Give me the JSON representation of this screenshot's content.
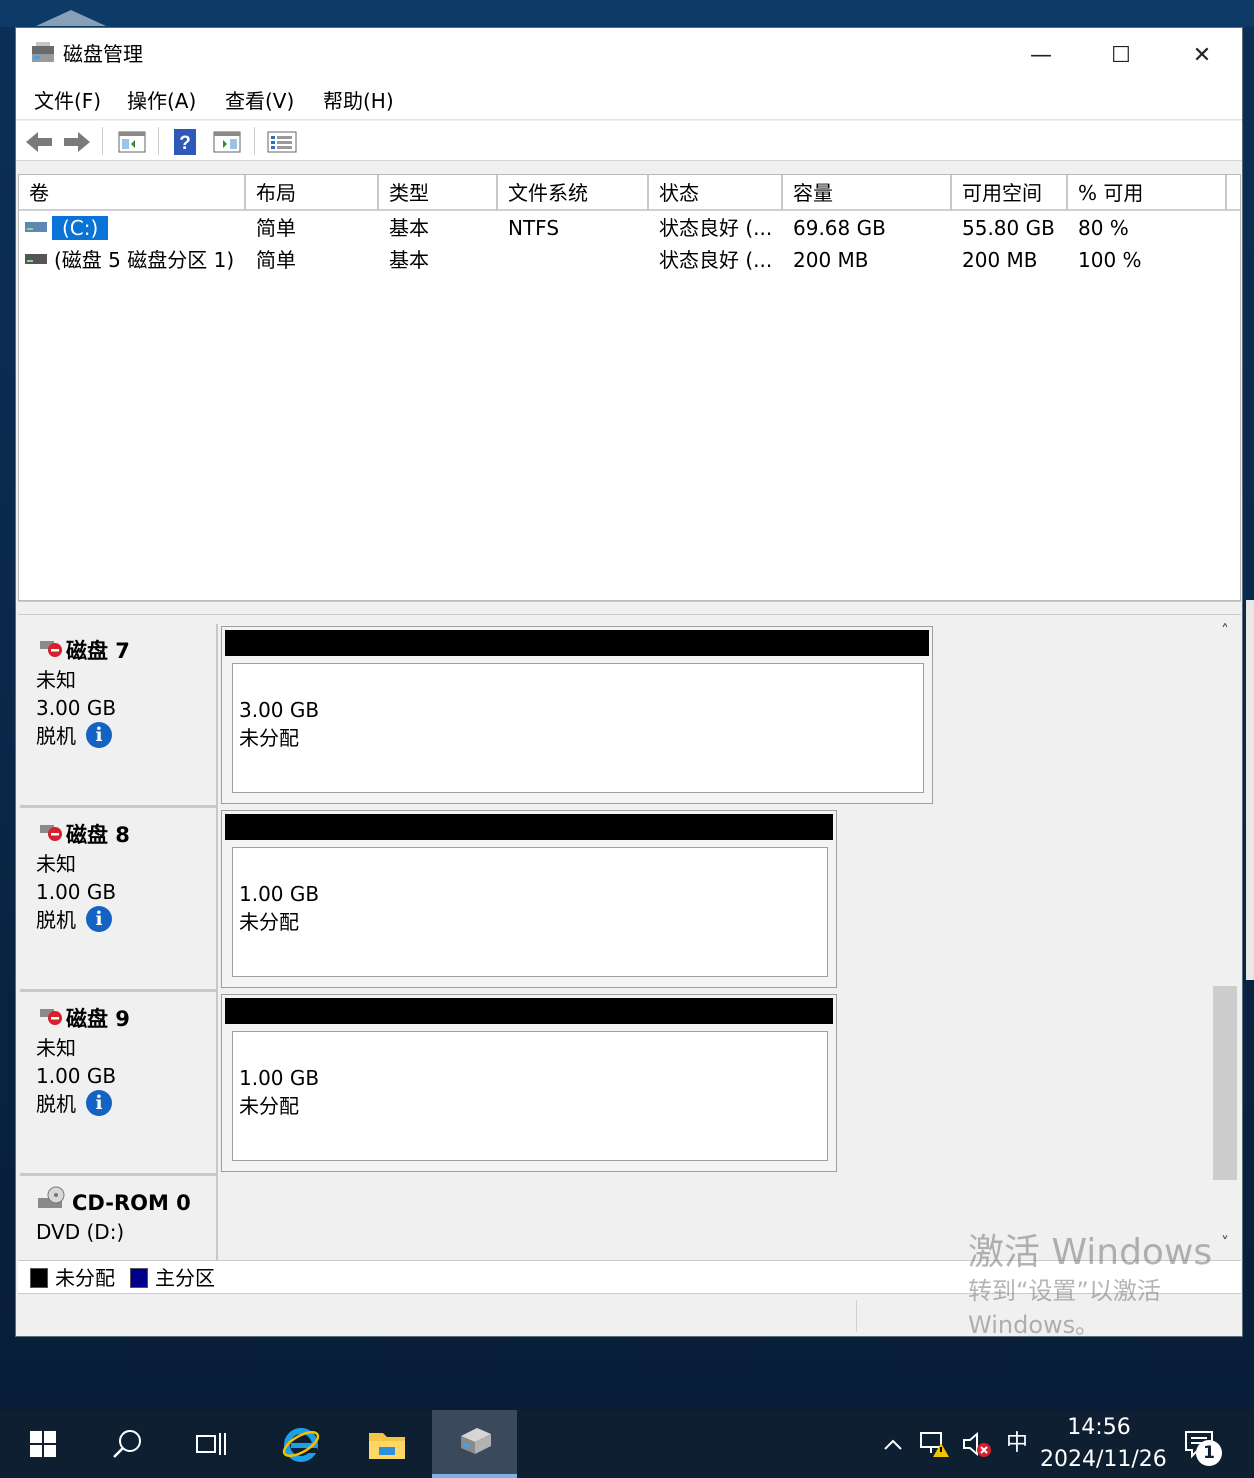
{
  "window": {
    "title": "磁盘管理",
    "controls": {
      "minimize": "—",
      "maximize": "☐",
      "close": "✕"
    }
  },
  "menu": [
    {
      "label": "文件(F)"
    },
    {
      "label": "操作(A)"
    },
    {
      "label": "查看(V)"
    },
    {
      "label": "帮助(H)"
    }
  ],
  "toolbar": {
    "icons": [
      "back-arrow-icon",
      "forward-arrow-icon",
      "show-hide-console-tree-icon",
      "help-icon",
      "show-action-pane-icon",
      "properties-list-icon"
    ]
  },
  "volume_list": {
    "columns": [
      "卷",
      "布局",
      "类型",
      "文件系统",
      "状态",
      "容量",
      "可用空间",
      "% 可用"
    ],
    "rows": [
      {
        "volume": "(C:)",
        "layout": "简单",
        "type": "基本",
        "fs": "NTFS",
        "status": "状态良好 (...",
        "capacity": "69.68 GB",
        "free": "55.80 GB",
        "pct": "80 %"
      },
      {
        "volume": "(磁盘 5 磁盘分区 1)",
        "layout": "简单",
        "type": "基本",
        "fs": "",
        "status": "状态良好 (...",
        "capacity": "200 MB",
        "free": "200 MB",
        "pct": "100 %"
      }
    ]
  },
  "disks": [
    {
      "name": "磁盘 7",
      "kind": "未知",
      "size": "3.00 GB",
      "state": "脱机",
      "partition": {
        "size": "3.00 GB",
        "status": "未分配"
      }
    },
    {
      "name": "磁盘 8",
      "kind": "未知",
      "size": "1.00 GB",
      "state": "脱机",
      "partition": {
        "size": "1.00 GB",
        "status": "未分配"
      }
    },
    {
      "name": "磁盘 9",
      "kind": "未知",
      "size": "1.00 GB",
      "state": "脱机",
      "partition": {
        "size": "1.00 GB",
        "status": "未分配"
      }
    }
  ],
  "cdrom": {
    "name": "CD-ROM 0",
    "detail": "DVD (D:)"
  },
  "legend": [
    {
      "label": "未分配",
      "color": "#000000"
    },
    {
      "label": "主分区",
      "color": "#00008b"
    }
  ],
  "colors": {
    "selection": "#0a73d7",
    "offline_icon": "#d4202f",
    "info_icon": "#1462c4"
  },
  "watermark": {
    "title": "激活 Windows",
    "subtitle": "转到“设置”以激活",
    "subtitle2": "Windows。"
  },
  "scrollbar": {
    "up": "˄",
    "down": "˅"
  },
  "taskbar": {
    "time": "14:56",
    "date": "2024/11/26",
    "ime": "中",
    "notification_count": "1"
  }
}
